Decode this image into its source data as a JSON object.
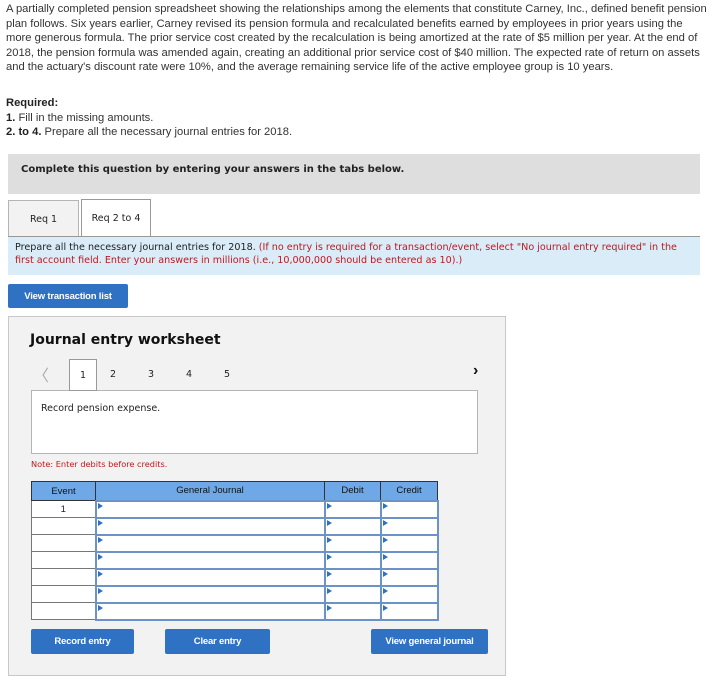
{
  "intro": {
    "text": "A partially completed pension spreadsheet showing the relationships among the elements that constitute Carney, Inc., defined benefit pension plan follows. Six years earlier, Carney revised its pension formula and recalculated benefits earned by employees in prior years using the more generous formula. The prior service cost created by the recalculation is being amortized at the rate of $5 million per year. At the end of 2018, the pension formula was amended again, creating an additional prior service cost of $40 million. The expected rate of return on assets and the actuary's discount rate were 10%, and the average remaining service life of the active employee group is 10 years."
  },
  "required": {
    "heading": "Required:",
    "items": [
      {
        "num": "1.",
        "text": " Fill in the missing amounts."
      },
      {
        "num": "2. to 4.",
        "text": " Prepare all the necessary journal entries for 2018."
      }
    ]
  },
  "complete_box": {
    "text": "Complete this question by entering your answers in the tabs below."
  },
  "tabs": [
    {
      "label": "Req 1",
      "active": false
    },
    {
      "label": "Req 2 to 4",
      "active": true
    }
  ],
  "instructions": {
    "main": "Prepare all the necessary journal entries for 2018. ",
    "note": "(If no entry is required for a transaction/event, select \"No journal entry required\" in the first account field. Enter your answers in millions (i.e., 10,000,000 should be entered as 10).)"
  },
  "buttons": {
    "view_transaction_list": "View transaction list",
    "record_entry": "Record entry",
    "clear_entry": "Clear entry",
    "view_general_journal": "View general journal"
  },
  "worksheet": {
    "title": "Journal entry worksheet",
    "prev_icon": "chevron-left",
    "next_icon": "chevron-right",
    "pages": [
      "1",
      "2",
      "3",
      "4",
      "5"
    ],
    "active_page": "1",
    "description": "Record pension expense.",
    "note": "Note: Enter debits before credits.",
    "table": {
      "headers": [
        "Event",
        "General Journal",
        "Debit",
        "Credit"
      ],
      "rows": [
        {
          "event": "1",
          "account": "",
          "debit": "",
          "credit": ""
        },
        {
          "event": "",
          "account": "",
          "debit": "",
          "credit": ""
        },
        {
          "event": "",
          "account": "",
          "debit": "",
          "credit": ""
        },
        {
          "event": "",
          "account": "",
          "debit": "",
          "credit": ""
        },
        {
          "event": "",
          "account": "",
          "debit": "",
          "credit": ""
        },
        {
          "event": "",
          "account": "",
          "debit": "",
          "credit": ""
        },
        {
          "event": "",
          "account": "",
          "debit": "",
          "credit": ""
        }
      ]
    }
  },
  "colors": {
    "button_blue": "#2f72c3",
    "table_header": "#6fa8e6",
    "info_box": "#d9ecf8",
    "note_red": "#c0181e"
  }
}
